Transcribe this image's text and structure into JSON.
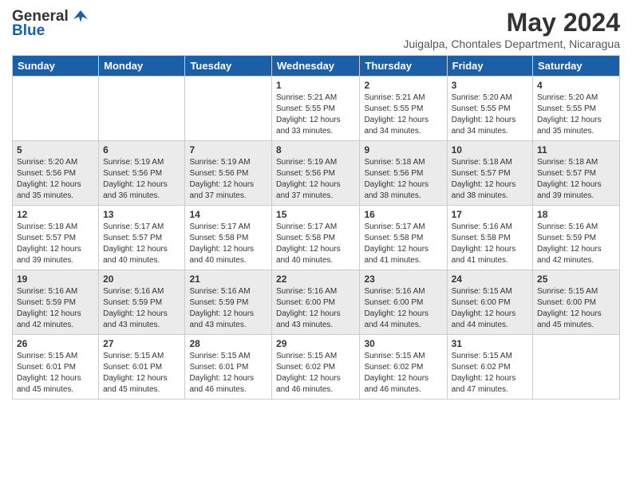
{
  "header": {
    "logo_general": "General",
    "logo_blue": "Blue",
    "title": "May 2024",
    "subtitle": "Juigalpa, Chontales Department, Nicaragua"
  },
  "weekdays": [
    "Sunday",
    "Monday",
    "Tuesday",
    "Wednesday",
    "Thursday",
    "Friday",
    "Saturday"
  ],
  "weeks": [
    [
      {
        "day": "",
        "sunrise": "",
        "sunset": "",
        "daylight": ""
      },
      {
        "day": "",
        "sunrise": "",
        "sunset": "",
        "daylight": ""
      },
      {
        "day": "",
        "sunrise": "",
        "sunset": "",
        "daylight": ""
      },
      {
        "day": "1",
        "sunrise": "5:21 AM",
        "sunset": "5:55 PM",
        "daylight": "12 hours and 33 minutes."
      },
      {
        "day": "2",
        "sunrise": "5:21 AM",
        "sunset": "5:55 PM",
        "daylight": "12 hours and 34 minutes."
      },
      {
        "day": "3",
        "sunrise": "5:20 AM",
        "sunset": "5:55 PM",
        "daylight": "12 hours and 34 minutes."
      },
      {
        "day": "4",
        "sunrise": "5:20 AM",
        "sunset": "5:55 PM",
        "daylight": "12 hours and 35 minutes."
      }
    ],
    [
      {
        "day": "5",
        "sunrise": "5:20 AM",
        "sunset": "5:56 PM",
        "daylight": "12 hours and 35 minutes."
      },
      {
        "day": "6",
        "sunrise": "5:19 AM",
        "sunset": "5:56 PM",
        "daylight": "12 hours and 36 minutes."
      },
      {
        "day": "7",
        "sunrise": "5:19 AM",
        "sunset": "5:56 PM",
        "daylight": "12 hours and 37 minutes."
      },
      {
        "day": "8",
        "sunrise": "5:19 AM",
        "sunset": "5:56 PM",
        "daylight": "12 hours and 37 minutes."
      },
      {
        "day": "9",
        "sunrise": "5:18 AM",
        "sunset": "5:56 PM",
        "daylight": "12 hours and 38 minutes."
      },
      {
        "day": "10",
        "sunrise": "5:18 AM",
        "sunset": "5:57 PM",
        "daylight": "12 hours and 38 minutes."
      },
      {
        "day": "11",
        "sunrise": "5:18 AM",
        "sunset": "5:57 PM",
        "daylight": "12 hours and 39 minutes."
      }
    ],
    [
      {
        "day": "12",
        "sunrise": "5:18 AM",
        "sunset": "5:57 PM",
        "daylight": "12 hours and 39 minutes."
      },
      {
        "day": "13",
        "sunrise": "5:17 AM",
        "sunset": "5:57 PM",
        "daylight": "12 hours and 40 minutes."
      },
      {
        "day": "14",
        "sunrise": "5:17 AM",
        "sunset": "5:58 PM",
        "daylight": "12 hours and 40 minutes."
      },
      {
        "day": "15",
        "sunrise": "5:17 AM",
        "sunset": "5:58 PM",
        "daylight": "12 hours and 40 minutes."
      },
      {
        "day": "16",
        "sunrise": "5:17 AM",
        "sunset": "5:58 PM",
        "daylight": "12 hours and 41 minutes."
      },
      {
        "day": "17",
        "sunrise": "5:16 AM",
        "sunset": "5:58 PM",
        "daylight": "12 hours and 41 minutes."
      },
      {
        "day": "18",
        "sunrise": "5:16 AM",
        "sunset": "5:59 PM",
        "daylight": "12 hours and 42 minutes."
      }
    ],
    [
      {
        "day": "19",
        "sunrise": "5:16 AM",
        "sunset": "5:59 PM",
        "daylight": "12 hours and 42 minutes."
      },
      {
        "day": "20",
        "sunrise": "5:16 AM",
        "sunset": "5:59 PM",
        "daylight": "12 hours and 43 minutes."
      },
      {
        "day": "21",
        "sunrise": "5:16 AM",
        "sunset": "5:59 PM",
        "daylight": "12 hours and 43 minutes."
      },
      {
        "day": "22",
        "sunrise": "5:16 AM",
        "sunset": "6:00 PM",
        "daylight": "12 hours and 43 minutes."
      },
      {
        "day": "23",
        "sunrise": "5:16 AM",
        "sunset": "6:00 PM",
        "daylight": "12 hours and 44 minutes."
      },
      {
        "day": "24",
        "sunrise": "5:15 AM",
        "sunset": "6:00 PM",
        "daylight": "12 hours and 44 minutes."
      },
      {
        "day": "25",
        "sunrise": "5:15 AM",
        "sunset": "6:00 PM",
        "daylight": "12 hours and 45 minutes."
      }
    ],
    [
      {
        "day": "26",
        "sunrise": "5:15 AM",
        "sunset": "6:01 PM",
        "daylight": "12 hours and 45 minutes."
      },
      {
        "day": "27",
        "sunrise": "5:15 AM",
        "sunset": "6:01 PM",
        "daylight": "12 hours and 45 minutes."
      },
      {
        "day": "28",
        "sunrise": "5:15 AM",
        "sunset": "6:01 PM",
        "daylight": "12 hours and 46 minutes."
      },
      {
        "day": "29",
        "sunrise": "5:15 AM",
        "sunset": "6:02 PM",
        "daylight": "12 hours and 46 minutes."
      },
      {
        "day": "30",
        "sunrise": "5:15 AM",
        "sunset": "6:02 PM",
        "daylight": "12 hours and 46 minutes."
      },
      {
        "day": "31",
        "sunrise": "5:15 AM",
        "sunset": "6:02 PM",
        "daylight": "12 hours and 47 minutes."
      },
      {
        "day": "",
        "sunrise": "",
        "sunset": "",
        "daylight": ""
      }
    ]
  ],
  "colors": {
    "header_bg": "#1a5fa8",
    "header_text": "#ffffff",
    "row_odd": "#ffffff",
    "row_even": "#ebebeb",
    "border": "#cccccc"
  }
}
